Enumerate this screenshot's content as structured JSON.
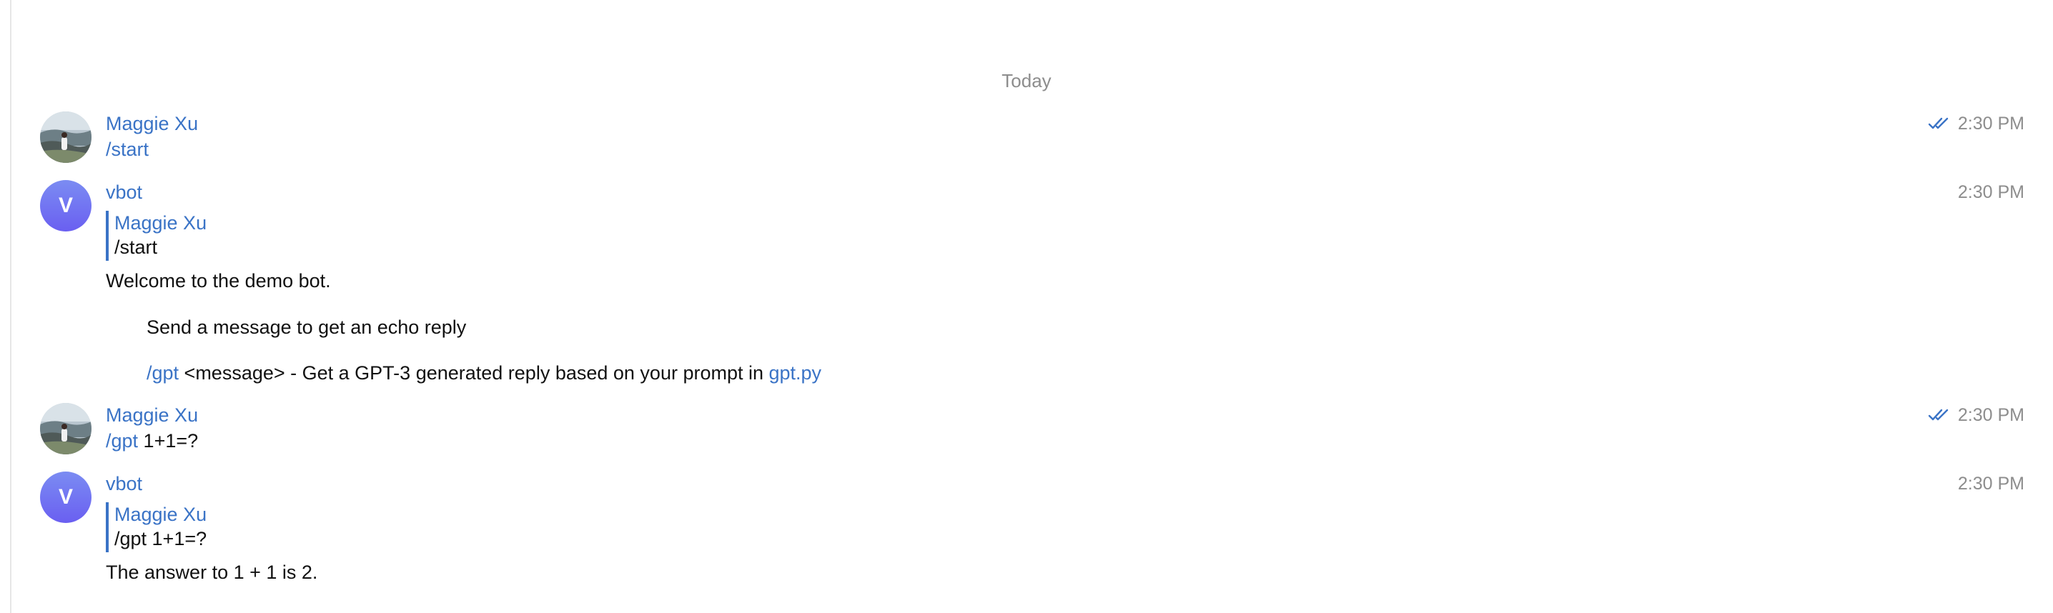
{
  "date_separator": "Today",
  "messages": [
    {
      "sender": "Maggie Xu",
      "avatar": "photo",
      "time": "2:30 PM",
      "read_icon": "double-check-icon",
      "text": "/start"
    },
    {
      "sender": "vbot",
      "avatar_initial": "V",
      "time": "2:30 PM",
      "reply_to": {
        "name": "Maggie Xu",
        "text": "/start"
      },
      "welcome": "Welcome to the demo bot.",
      "help_line1": "Send a message to get an echo reply",
      "help_line2_cmd": "/gpt",
      "help_line2_text": " <message> - Get a GPT-3 generated reply based on your prompt in ",
      "help_line2_link": "gpt.py"
    },
    {
      "sender": "Maggie Xu",
      "avatar": "photo",
      "time": "2:30 PM",
      "read_icon": "double-check-icon",
      "cmd": "/gpt",
      "text": " 1+1=?"
    },
    {
      "sender": "vbot",
      "avatar_initial": "V",
      "time": "2:30 PM",
      "reply_to": {
        "name": "Maggie Xu",
        "text": "/gpt 1+1=?"
      },
      "text": "The answer to 1 + 1 is 2."
    }
  ],
  "colors": {
    "link": "#3a73c6",
    "muted": "#8d8d8d",
    "bot_avatar_top": "#7b8cf2",
    "bot_avatar_bottom": "#6a5ff1"
  }
}
